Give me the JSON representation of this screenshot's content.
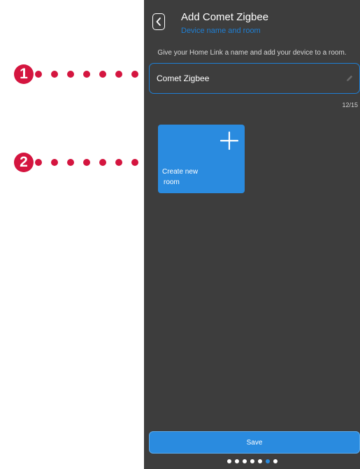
{
  "header": {
    "title": "Add Comet Zigbee",
    "subtitle": "Device name and room",
    "back_icon": "chevron-left-icon"
  },
  "form": {
    "instruction": "Give your Home Link a name and add your device to a room.",
    "name_value": "Comet Zigbee",
    "char_counter": "12/15",
    "edit_icon": "pencil-icon"
  },
  "rooms": {
    "create_label": "Create new\nroom",
    "create_icon": "plus-icon"
  },
  "footer": {
    "save_label": "Save",
    "steps_total": 7,
    "current_step": 6
  },
  "callouts": [
    "1",
    "2"
  ],
  "colors": {
    "screen_bg": "#3d3d3d",
    "accent": "#2a8bdf",
    "callout": "#d4153f"
  }
}
